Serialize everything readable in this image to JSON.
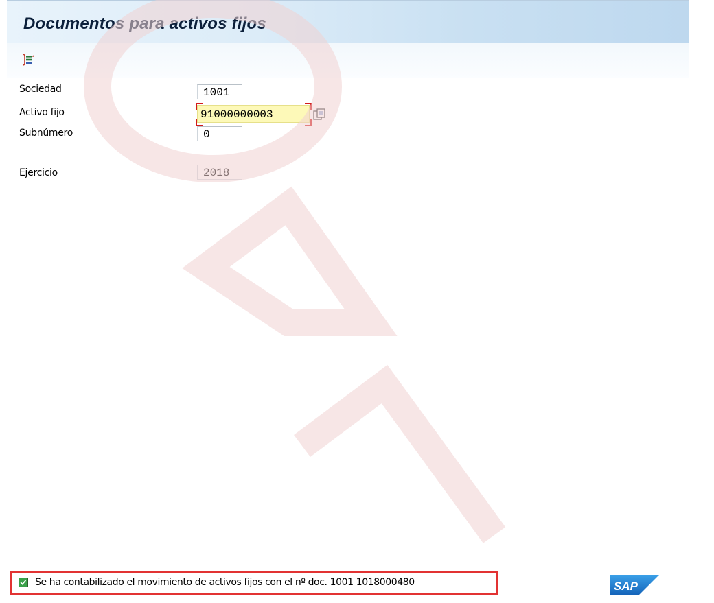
{
  "window": {
    "title": "Documentos para activos fijos"
  },
  "toolbar": {
    "icons": [
      "execute-icon"
    ]
  },
  "form": {
    "sociedad": {
      "label": "Sociedad",
      "value": "1001"
    },
    "activo_fijo": {
      "label": "Activo fijo",
      "value": "91000000003"
    },
    "subnumero": {
      "label": "Subnúmero",
      "value": "0"
    },
    "ejercicio": {
      "label": "Ejercicio",
      "value": "2018"
    }
  },
  "status": {
    "type": "success",
    "message": "Se ha contabilizado el movimiento de activos fijos con el nº doc. 1001 1018000480"
  },
  "branding": {
    "logo": "SAP"
  },
  "watermark": {
    "text": "ONA"
  },
  "colors": {
    "title_text": "#0b1f3a",
    "active_field": "#fdf9b8",
    "focus_corner": "#d21b1b",
    "status_highlight": "#e23333",
    "success_check": "#3aa14a",
    "sap_blue": "#1a73c8"
  }
}
